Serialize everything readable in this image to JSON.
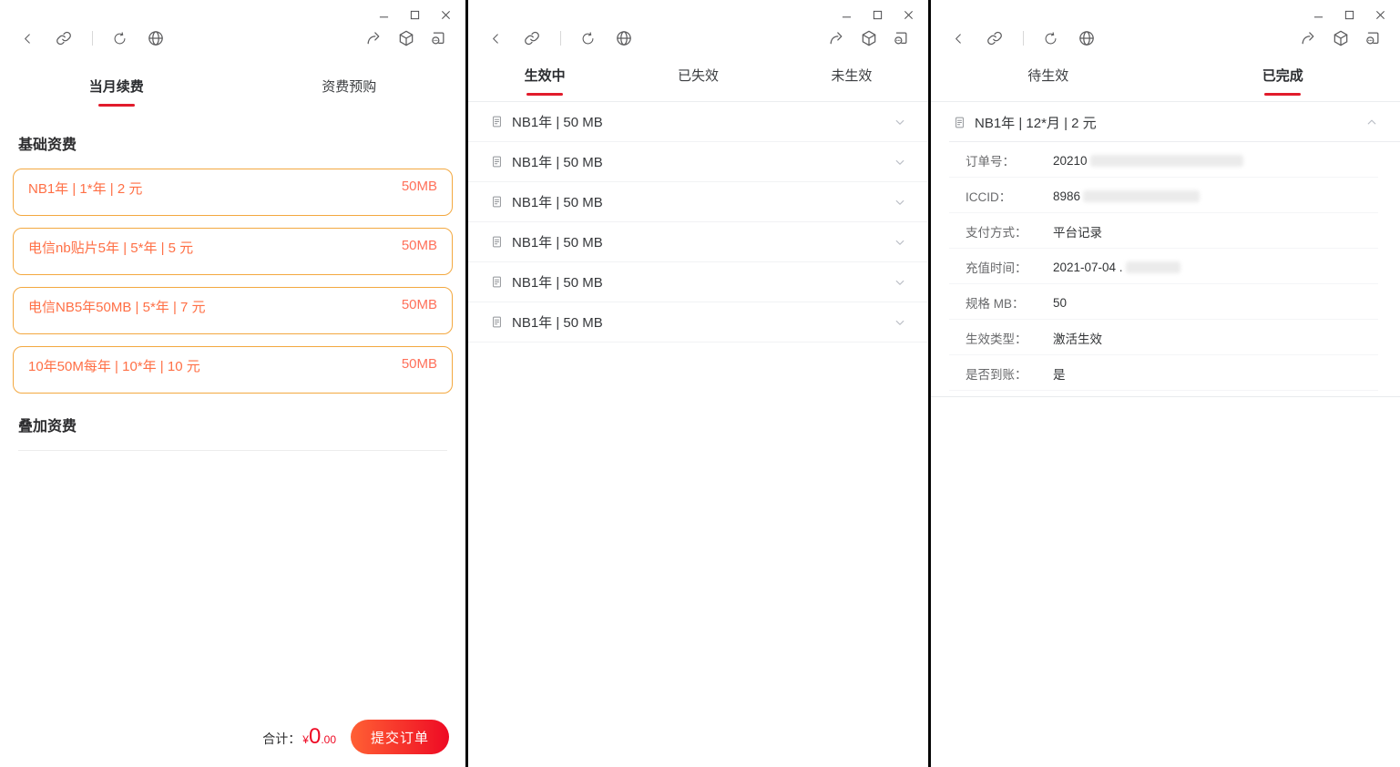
{
  "colors": {
    "tab_underline_red": "#e11b2b",
    "price_red": "#ee0a24",
    "submit_gradient_start": "#ff6034",
    "submit_gradient_end": "#ee0a24",
    "card_border_orange": "#f3a840",
    "card_text_orange": "#ff6f45"
  },
  "window1": {
    "tabs": [
      {
        "label": "当月续费",
        "active": true
      },
      {
        "label": "资费预购",
        "active": false
      }
    ],
    "section_basic": "基础资费",
    "section_addon": "叠加资费",
    "plans": [
      {
        "name": "NB1年 | 1*年 | 2 元",
        "size": "50MB"
      },
      {
        "name": "电信nb贴片5年 | 5*年 | 5 元",
        "size": "50MB"
      },
      {
        "name": "电信NB5年50MB | 5*年 | 7 元",
        "size": "50MB"
      },
      {
        "name": "10年50M每年 | 10*年 | 10 元",
        "size": "50MB"
      }
    ],
    "footer": {
      "total_label": "合计：",
      "currency": "¥",
      "amount_int": "0",
      "amount_dec": ".00",
      "submit_label": "提交订单"
    }
  },
  "window2": {
    "tabs": [
      {
        "label": "生效中",
        "active": true
      },
      {
        "label": "已失效",
        "active": false
      },
      {
        "label": "未生效",
        "active": false
      }
    ],
    "items": [
      {
        "title": "NB1年 | 50 MB"
      },
      {
        "title": "NB1年 | 50 MB"
      },
      {
        "title": "NB1年 | 50 MB"
      },
      {
        "title": "NB1年 | 50 MB"
      },
      {
        "title": "NB1年 | 50 MB"
      },
      {
        "title": "NB1年 | 50 MB"
      }
    ]
  },
  "window3": {
    "tabs": [
      {
        "label": "待生效",
        "active": false
      },
      {
        "label": "已完成",
        "active": true
      }
    ],
    "order": {
      "title": "NB1年 | 12*月 | 2 元",
      "details": [
        {
          "label": "订单号：",
          "value": "20210",
          "redacted": true
        },
        {
          "label": "ICCID：",
          "value": "8986",
          "redacted": true
        },
        {
          "label": "支付方式：",
          "value": "平台记录",
          "redacted": false
        },
        {
          "label": "充值时间：",
          "value": "2021-07-04 .",
          "redacted": true
        },
        {
          "label": "规格 MB：",
          "value": "50",
          "redacted": false
        },
        {
          "label": "生效类型：",
          "value": "激活生效",
          "redacted": false
        },
        {
          "label": "是否到账：",
          "value": "是",
          "redacted": false
        }
      ]
    }
  }
}
